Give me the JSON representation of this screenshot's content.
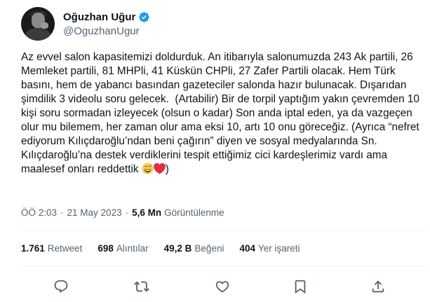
{
  "user": {
    "display_name": "Oğuzhan Uğur",
    "handle": "@OguzhanUgur"
  },
  "tweet": {
    "text_main": "Az evvel salon kapasitemizi doldurduk. An itibarıyla salonumuzda 243 Ak partili, 26 Memleket partili, 81 MHPli, 41 Küskün CHPli, 27 Zafer Partili olacak. Hem Türk basını, hem de yabancı basından gazeteciler salonda hazır bulunacak. Dışarıdan şimdilik 3 videolu soru gelecek.  (Artabilir) Bir de torpil yaptığım yakın çevremden 10 kişi soru sormadan izleyecek (olsun o kadar) Son anda iptal eden, ya da vazgeçen olur mu bilemem, her zaman olur ama eksi 10, artı 10 onu göreceğiz. (Ayrıca “nefret ediyorum Kılıçdaroğlu’ndan beni çağırın” diyen ve sosyal medyalarında Sn. Kılıçdaroğlu’na destek verdiklerini tespit ettiğimiz cici kardeşlerimiz vardı ama maalesef onları reddettik ",
    "text_end": ")"
  },
  "meta": {
    "time": "ÖÖ 2:03",
    "separator": "·",
    "date": "21 May 2023",
    "views_count": "5,6 Mn",
    "views_label": "Görüntülenme"
  },
  "stats": [
    {
      "count": "1.761",
      "label": "Retweet"
    },
    {
      "count": "698",
      "label": "Alıntılar"
    },
    {
      "count": "49,2 B",
      "label": "Beğeni"
    },
    {
      "count": "404",
      "label": "Yer işareti"
    }
  ],
  "icons": {
    "verified": "verified-badge-icon",
    "emoji_1": "sweat-smile-emoji",
    "emoji_2": "red-heart-emoji",
    "reply": "reply-icon",
    "retweet": "retweet-icon",
    "like": "heart-icon",
    "bookmark": "bookmark-icon",
    "share": "share-icon"
  },
  "colors": {
    "verified_blue": "#1d9bf0",
    "secondary_text": "#536471",
    "primary_text": "#0f1419",
    "divider": "#eff3f4"
  }
}
